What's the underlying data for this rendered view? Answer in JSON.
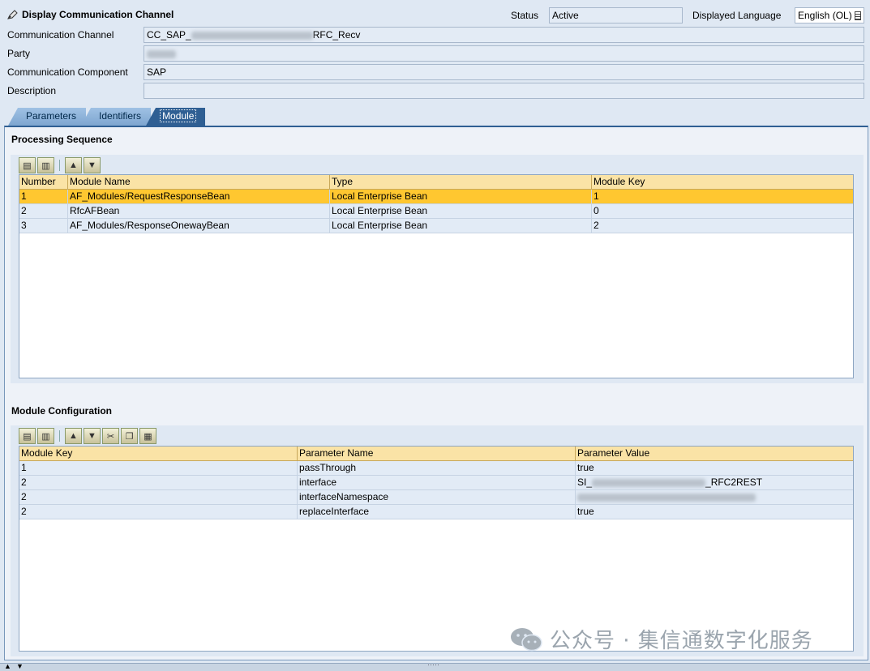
{
  "header": {
    "title": "Display Communication Channel",
    "status_label": "Status",
    "status_value": "Active",
    "language_label": "Displayed Language",
    "language_value": "English (OL)",
    "fields": {
      "channel_label": "Communication Channel",
      "channel_value_prefix": "CC_SAP_",
      "channel_value_suffix": "RFC_Recv",
      "party_label": "Party",
      "component_label": "Communication Component",
      "component_value": "SAP",
      "description_label": "Description"
    }
  },
  "tabs": [
    {
      "label": "Parameters"
    },
    {
      "label": "Identifiers"
    },
    {
      "label": "Module",
      "active": true
    }
  ],
  "processing": {
    "title": "Processing Sequence",
    "columns": [
      "Number",
      "Module Name",
      "Type",
      "Module Key"
    ],
    "rows": [
      [
        "1",
        "AF_Modules/RequestResponseBean",
        "Local Enterprise Bean",
        "1"
      ],
      [
        "2",
        "RfcAFBean",
        "Local Enterprise Bean",
        "0"
      ],
      [
        "3",
        "AF_Modules/ResponseOnewayBean",
        "Local Enterprise Bean",
        "2"
      ]
    ]
  },
  "config": {
    "title": "Module Configuration",
    "columns": [
      "Module Key",
      "Parameter Name",
      "Parameter Value"
    ],
    "rows": [
      [
        "1",
        "passThrough",
        "true"
      ],
      [
        "2",
        "interface",
        "SI_",
        "_RFC2REST"
      ],
      [
        "2",
        "interfaceNamespace",
        ""
      ],
      [
        "2",
        "replaceInterface",
        "true"
      ]
    ]
  },
  "watermark": "公众号 · 集信通数字化服务",
  "colors": {
    "selected_row": "#ffc730",
    "header_row": "#fae3a6",
    "tab_active": "#2f5f93"
  }
}
